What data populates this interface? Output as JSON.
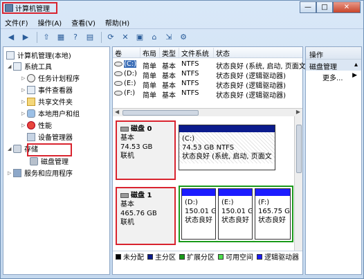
{
  "window": {
    "title": "计算机管理",
    "buttons": {
      "minimize": "—",
      "maximize": "□",
      "close": "✕"
    }
  },
  "menu": [
    "文件(F)",
    "操作(A)",
    "查看(V)",
    "帮助(H)"
  ],
  "toolbar": [
    "back-icon",
    "forward-icon",
    "up-folder-icon",
    "show-hide-tree-icon",
    "help-pane-icon",
    "properties-icon",
    "refresh-icon",
    "delete-icon",
    "open-properties-icon",
    "open-folder-icon",
    "export-icon",
    "help-icon"
  ],
  "tree": {
    "root": "计算机管理(本地)",
    "system_tools": "系统工具",
    "task_scheduler": "任务计划程序",
    "event_viewer": "事件查看器",
    "shared_folders": "共享文件夹",
    "local_users": "本地用户和组",
    "performance": "性能",
    "device_manager": "设备管理器",
    "storage": "存储",
    "disk_management": "磁盘管理",
    "services": "服务和应用程序"
  },
  "volume_table": {
    "headers": [
      "卷",
      "布局",
      "类型",
      "文件系统",
      "状态"
    ],
    "rows": [
      {
        "vol": "(C:)",
        "layout": "简单",
        "type": "基本",
        "fs": "NTFS",
        "status": "状态良好 (系统, 启动, 页面文"
      },
      {
        "vol": "(D:)",
        "layout": "简单",
        "type": "基本",
        "fs": "NTFS",
        "status": "状态良好 (逻辑驱动器)"
      },
      {
        "vol": "(E:)",
        "layout": "简单",
        "type": "基本",
        "fs": "NTFS",
        "status": "状态良好 (逻辑驱动器)"
      },
      {
        "vol": "(F:)",
        "layout": "简单",
        "type": "基本",
        "fs": "NTFS",
        "status": "状态良好 (逻辑驱动器)"
      }
    ]
  },
  "disks": [
    {
      "name": "磁盘 0",
      "type": "基本",
      "size": "74.53 GB",
      "state": "联机",
      "partition": {
        "letter": "(C:)",
        "size": "74.53 GB NTFS",
        "status": "状态良好 (系统, 启动, 页面文"
      }
    },
    {
      "name": "磁盘 1",
      "type": "基本",
      "size": "465.76 GB",
      "state": "联机",
      "partitions": [
        {
          "letter": "(D:)",
          "size": "150.01 G",
          "status": "状态良好"
        },
        {
          "letter": "(E:)",
          "size": "150.01 G",
          "status": "状态良好"
        },
        {
          "letter": "(F:)",
          "size": "165.75 G",
          "status": "状态良好"
        }
      ]
    }
  ],
  "legend": [
    {
      "label": "未分配",
      "color": "#000000"
    },
    {
      "label": "主分区",
      "color": "#0b1b8c"
    },
    {
      "label": "扩展分区",
      "color": "#1a9a1a"
    },
    {
      "label": "可用空间",
      "color": "#4dde4d"
    },
    {
      "label": "逻辑驱动器",
      "color": "#1c1cff"
    }
  ],
  "actions": {
    "title": "操作",
    "section": "磁盘管理",
    "more": "更多..."
  }
}
